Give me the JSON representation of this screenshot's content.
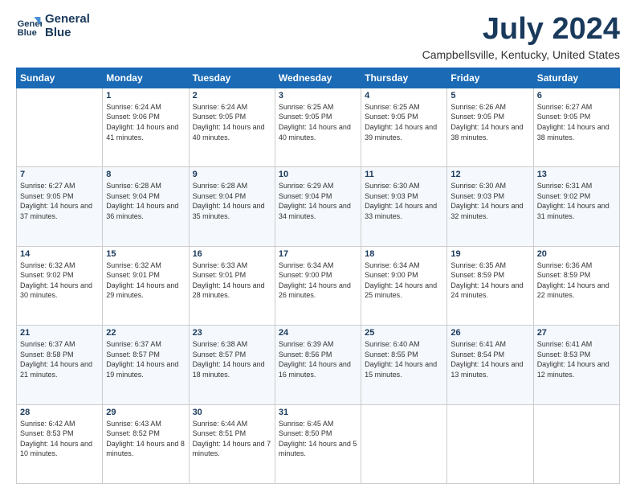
{
  "logo": {
    "line1": "General",
    "line2": "Blue"
  },
  "title": "July 2024",
  "location": "Campbellsville, Kentucky, United States",
  "weekdays": [
    "Sunday",
    "Monday",
    "Tuesday",
    "Wednesday",
    "Thursday",
    "Friday",
    "Saturday"
  ],
  "weeks": [
    [
      {
        "day": "",
        "sunrise": "",
        "sunset": "",
        "daylight": ""
      },
      {
        "day": "1",
        "sunrise": "Sunrise: 6:24 AM",
        "sunset": "Sunset: 9:06 PM",
        "daylight": "Daylight: 14 hours and 41 minutes."
      },
      {
        "day": "2",
        "sunrise": "Sunrise: 6:24 AM",
        "sunset": "Sunset: 9:05 PM",
        "daylight": "Daylight: 14 hours and 40 minutes."
      },
      {
        "day": "3",
        "sunrise": "Sunrise: 6:25 AM",
        "sunset": "Sunset: 9:05 PM",
        "daylight": "Daylight: 14 hours and 40 minutes."
      },
      {
        "day": "4",
        "sunrise": "Sunrise: 6:25 AM",
        "sunset": "Sunset: 9:05 PM",
        "daylight": "Daylight: 14 hours and 39 minutes."
      },
      {
        "day": "5",
        "sunrise": "Sunrise: 6:26 AM",
        "sunset": "Sunset: 9:05 PM",
        "daylight": "Daylight: 14 hours and 38 minutes."
      },
      {
        "day": "6",
        "sunrise": "Sunrise: 6:27 AM",
        "sunset": "Sunset: 9:05 PM",
        "daylight": "Daylight: 14 hours and 38 minutes."
      }
    ],
    [
      {
        "day": "7",
        "sunrise": "Sunrise: 6:27 AM",
        "sunset": "Sunset: 9:05 PM",
        "daylight": "Daylight: 14 hours and 37 minutes."
      },
      {
        "day": "8",
        "sunrise": "Sunrise: 6:28 AM",
        "sunset": "Sunset: 9:04 PM",
        "daylight": "Daylight: 14 hours and 36 minutes."
      },
      {
        "day": "9",
        "sunrise": "Sunrise: 6:28 AM",
        "sunset": "Sunset: 9:04 PM",
        "daylight": "Daylight: 14 hours and 35 minutes."
      },
      {
        "day": "10",
        "sunrise": "Sunrise: 6:29 AM",
        "sunset": "Sunset: 9:04 PM",
        "daylight": "Daylight: 14 hours and 34 minutes."
      },
      {
        "day": "11",
        "sunrise": "Sunrise: 6:30 AM",
        "sunset": "Sunset: 9:03 PM",
        "daylight": "Daylight: 14 hours and 33 minutes."
      },
      {
        "day": "12",
        "sunrise": "Sunrise: 6:30 AM",
        "sunset": "Sunset: 9:03 PM",
        "daylight": "Daylight: 14 hours and 32 minutes."
      },
      {
        "day": "13",
        "sunrise": "Sunrise: 6:31 AM",
        "sunset": "Sunset: 9:02 PM",
        "daylight": "Daylight: 14 hours and 31 minutes."
      }
    ],
    [
      {
        "day": "14",
        "sunrise": "Sunrise: 6:32 AM",
        "sunset": "Sunset: 9:02 PM",
        "daylight": "Daylight: 14 hours and 30 minutes."
      },
      {
        "day": "15",
        "sunrise": "Sunrise: 6:32 AM",
        "sunset": "Sunset: 9:01 PM",
        "daylight": "Daylight: 14 hours and 29 minutes."
      },
      {
        "day": "16",
        "sunrise": "Sunrise: 6:33 AM",
        "sunset": "Sunset: 9:01 PM",
        "daylight": "Daylight: 14 hours and 28 minutes."
      },
      {
        "day": "17",
        "sunrise": "Sunrise: 6:34 AM",
        "sunset": "Sunset: 9:00 PM",
        "daylight": "Daylight: 14 hours and 26 minutes."
      },
      {
        "day": "18",
        "sunrise": "Sunrise: 6:34 AM",
        "sunset": "Sunset: 9:00 PM",
        "daylight": "Daylight: 14 hours and 25 minutes."
      },
      {
        "day": "19",
        "sunrise": "Sunrise: 6:35 AM",
        "sunset": "Sunset: 8:59 PM",
        "daylight": "Daylight: 14 hours and 24 minutes."
      },
      {
        "day": "20",
        "sunrise": "Sunrise: 6:36 AM",
        "sunset": "Sunset: 8:59 PM",
        "daylight": "Daylight: 14 hours and 22 minutes."
      }
    ],
    [
      {
        "day": "21",
        "sunrise": "Sunrise: 6:37 AM",
        "sunset": "Sunset: 8:58 PM",
        "daylight": "Daylight: 14 hours and 21 minutes."
      },
      {
        "day": "22",
        "sunrise": "Sunrise: 6:37 AM",
        "sunset": "Sunset: 8:57 PM",
        "daylight": "Daylight: 14 hours and 19 minutes."
      },
      {
        "day": "23",
        "sunrise": "Sunrise: 6:38 AM",
        "sunset": "Sunset: 8:57 PM",
        "daylight": "Daylight: 14 hours and 18 minutes."
      },
      {
        "day": "24",
        "sunrise": "Sunrise: 6:39 AM",
        "sunset": "Sunset: 8:56 PM",
        "daylight": "Daylight: 14 hours and 16 minutes."
      },
      {
        "day": "25",
        "sunrise": "Sunrise: 6:40 AM",
        "sunset": "Sunset: 8:55 PM",
        "daylight": "Daylight: 14 hours and 15 minutes."
      },
      {
        "day": "26",
        "sunrise": "Sunrise: 6:41 AM",
        "sunset": "Sunset: 8:54 PM",
        "daylight": "Daylight: 14 hours and 13 minutes."
      },
      {
        "day": "27",
        "sunrise": "Sunrise: 6:41 AM",
        "sunset": "Sunset: 8:53 PM",
        "daylight": "Daylight: 14 hours and 12 minutes."
      }
    ],
    [
      {
        "day": "28",
        "sunrise": "Sunrise: 6:42 AM",
        "sunset": "Sunset: 8:53 PM",
        "daylight": "Daylight: 14 hours and 10 minutes."
      },
      {
        "day": "29",
        "sunrise": "Sunrise: 6:43 AM",
        "sunset": "Sunset: 8:52 PM",
        "daylight": "Daylight: 14 hours and 8 minutes."
      },
      {
        "day": "30",
        "sunrise": "Sunrise: 6:44 AM",
        "sunset": "Sunset: 8:51 PM",
        "daylight": "Daylight: 14 hours and 7 minutes."
      },
      {
        "day": "31",
        "sunrise": "Sunrise: 6:45 AM",
        "sunset": "Sunset: 8:50 PM",
        "daylight": "Daylight: 14 hours and 5 minutes."
      },
      {
        "day": "",
        "sunrise": "",
        "sunset": "",
        "daylight": ""
      },
      {
        "day": "",
        "sunrise": "",
        "sunset": "",
        "daylight": ""
      },
      {
        "day": "",
        "sunrise": "",
        "sunset": "",
        "daylight": ""
      }
    ]
  ]
}
